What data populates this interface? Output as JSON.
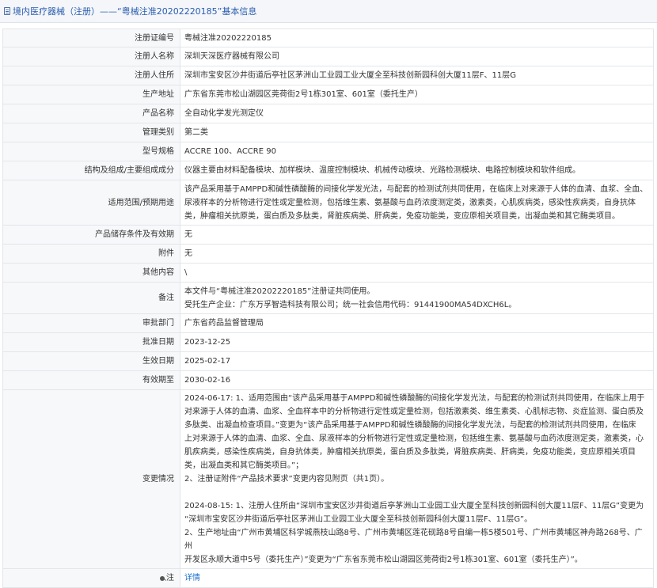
{
  "header": {
    "title": "境内医疗器械（注册）——“粤械注准20202220185”基本信息"
  },
  "rows": {
    "reg_no": {
      "label": "注册证编号",
      "value": "粤械注准20202220185"
    },
    "registrant": {
      "label": "注册人名称",
      "value": "深圳天深医疗器械有限公司"
    },
    "registrant_addr": {
      "label": "注册人住所",
      "value": "深圳市宝安区沙井街道后亭社区茅洲山工业园工业大厦全至科技创新园科创大厦11层F、11层G"
    },
    "production_addr": {
      "label": "生产地址",
      "value": "广东省东莞市松山湖园区莞荷街2号1栋301室、601室（委托生产）"
    },
    "product_name": {
      "label": "产品名称",
      "value": "全自动化学发光测定仪"
    },
    "mgmt_class": {
      "label": "管理类别",
      "value": "第二类"
    },
    "model": {
      "label": "型号规格",
      "value": "ACCRE 100、ACCRE 90"
    },
    "structure": {
      "label": "结构及组成/主要组成成分",
      "value": "仪器主要由材料配备模块、加样模块、温度控制模块、机械传动模块、光路检测模块、电路控制模块和软件组成。"
    },
    "scope": {
      "label": "适用范围/预期用途",
      "lines": [
        "该产品采用基于AMPPD和碱性磷酸酶的间接化学发光法，与配套的检测试剂共同使用，在临床上对来源于人体的血清、血浆、全血、",
        "尿液样本的分析物进行定性或定量检测，包括维生素、氨基酸与血药浓度测定类，激素类，心肌疾病类，感染性疾病类，自身抗体",
        "类，肿瘤相关抗原类，蛋白质及多肽类，肾脏疾病类、肝病类，免疫功能类，变应原相关项目类，出凝血类和其它酶类项目。"
      ]
    },
    "storage": {
      "label": "产品储存条件及有效期",
      "value": "无"
    },
    "attachment": {
      "label": "附件",
      "value": "无"
    },
    "other": {
      "label": "其他内容",
      "value": "\\"
    },
    "remark": {
      "label": "备注",
      "lines": [
        "本文件与“粤械注准20202220185”注册证共同使用。",
        "受托生产企业：广东万孚智造科技有限公司；统一社会信用代码：91441900MA54DXCH6L。"
      ]
    },
    "approval_dept": {
      "label": "审批部门",
      "value": "广东省药品监督管理局"
    },
    "approval_date": {
      "label": "批准日期",
      "value": "2023-12-25"
    },
    "effective_date": {
      "label": "生效日期",
      "value": "2025-02-17"
    },
    "expiry_date": {
      "label": "有效期至",
      "value": "2030-02-16"
    },
    "changes": {
      "label": "变更情况",
      "lines": [
        "2024-06-17: 1、适用范围由“该产品采用基于AMPPD和碱性磷酸酶的间接化学发光法，与配套的检测试剂共同使用，在临床上用于",
        "对来源于人体的血清、血浆、全血样本中的分析物进行定性或定量检测，包括激素类、维生素类、心肌标志物、炎症监测、蛋白质及",
        "多肽类、出凝血检查项目。”变更为“该产品采用基于AMPPD和碱性磷酸酶的间接化学发光法，与配套的检测试剂共同使用，在临床",
        "上对来源于人体的血清、血浆、全血、尿液样本的分析物进行定性或定量检测，包括维生素、氨基酸与血药浓度测定类，激素类，心",
        "肌疾病类，感染性疾病类，自身抗体类，肿瘤相关抗原类，蛋白质及多肽类，肾脏疾病类、肝病类，免疫功能类，变应原相关项目",
        "类，出凝血类和其它酶类项目。”；",
        "2、注册证附件“产品技术要求”变更内容见附页（共1页）。",
        "",
        "2024-08-15: 1、注册人住所由“深圳市宝安区沙井街道后亭茅洲山工业园工业大厦全至科技创新园科创大厦11层F、11层G”变更为",
        "“深圳市宝安区沙井街道后亭社区茅洲山工业园工业大厦全至科技创新园科创大厦11层F、11层G”。",
        "2、生产地址由“广州市黄埔区科学城燕枝山路8号、广州市黄埔区莲花砚路8号自编一栋5楼501号、广州市黄埔区神舟路268号、广州",
        "开发区永顺大道中5号（委托生产）”变更为“广东省东莞市松山湖园区莞荷街2号1栋301室、601室（委托生产）”。"
      ]
    },
    "note": {
      "label": "注",
      "link": "详情"
    }
  }
}
